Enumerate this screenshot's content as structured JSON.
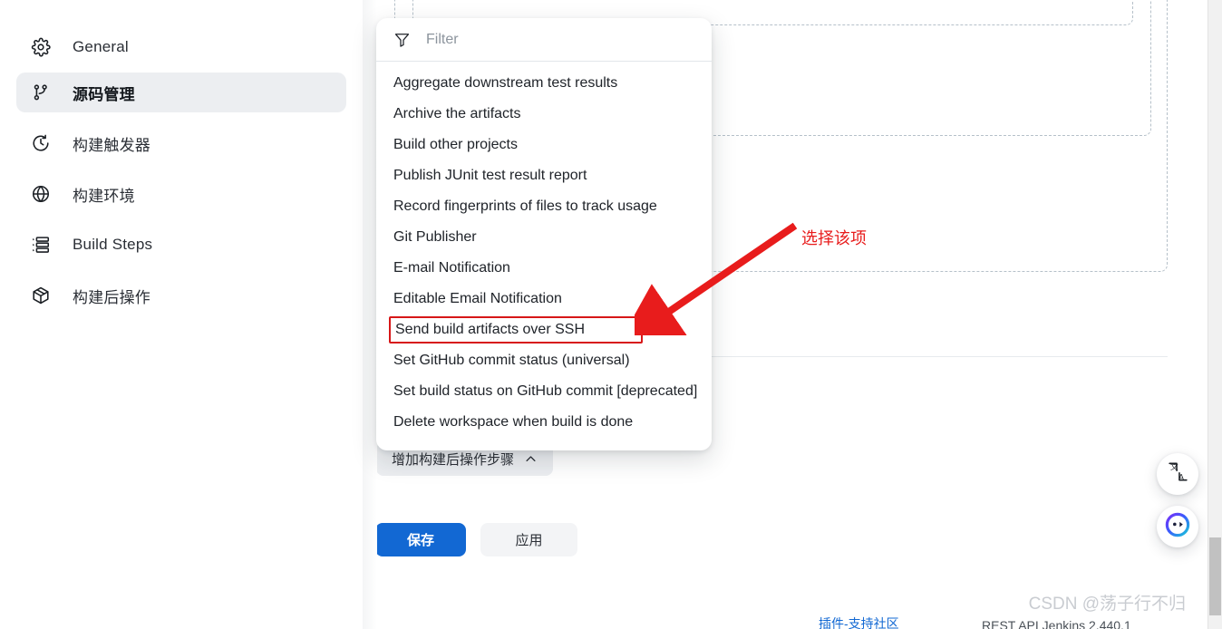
{
  "sidebar": {
    "items": [
      {
        "icon": "gear-icon",
        "label": "General",
        "selected": false
      },
      {
        "icon": "git-branch-icon",
        "label": "源码管理",
        "selected": true
      },
      {
        "icon": "clock-icon",
        "label": "构建触发器",
        "selected": false
      },
      {
        "icon": "globe-icon",
        "label": "构建环境",
        "selected": false
      },
      {
        "icon": "list-steps-icon",
        "label": "Build Steps",
        "selected": false
      },
      {
        "icon": "package-icon",
        "label": "构建后操作",
        "selected": false
      }
    ]
  },
  "dropdown": {
    "filter_icon": "funnel-icon",
    "filter_placeholder": "Filter",
    "filter_value": "",
    "items": [
      {
        "label": "Aggregate downstream test results",
        "highlighted": false
      },
      {
        "label": "Archive the artifacts",
        "highlighted": false
      },
      {
        "label": "Build other projects",
        "highlighted": false
      },
      {
        "label": "Publish JUnit test result report",
        "highlighted": false
      },
      {
        "label": "Record fingerprints of files to track usage",
        "highlighted": false
      },
      {
        "label": "Git Publisher",
        "highlighted": false
      },
      {
        "label": "E-mail Notification",
        "highlighted": false
      },
      {
        "label": "Editable Email Notification",
        "highlighted": false
      },
      {
        "label": "Send build artifacts over SSH",
        "highlighted": true
      },
      {
        "label": "Set GitHub commit status (universal)",
        "highlighted": false
      },
      {
        "label": "Set build status on GitHub commit [deprecated]",
        "highlighted": false
      },
      {
        "label": "Delete workspace when build is done",
        "highlighted": false
      }
    ]
  },
  "main": {
    "add_step_button": "增加构建后操作步骤",
    "add_step_chevron": "chevron-up-icon",
    "save_button": "保存",
    "apply_button": "应用"
  },
  "annotation": {
    "text": "选择该项",
    "color": "#e81c1c",
    "highlight_box_color": "#d71718"
  },
  "floating_buttons": [
    {
      "name": "translate-fab",
      "icon": "translate-icon",
      "label": "文A"
    },
    {
      "name": "assistant-fab",
      "icon": "assistant-face-icon",
      "label": ""
    }
  ],
  "footer": {
    "watermark": "CSDN @荡子行不归",
    "link_text": "插件-支持社区",
    "note_text": "REST API    Jenkins 2.440.1"
  },
  "colors": {
    "accent_blue": "#1268d3",
    "sidebar_selected": "#eceef1",
    "dashed_border": "#b5c0c9",
    "annotation_red": "#e81c1c"
  }
}
